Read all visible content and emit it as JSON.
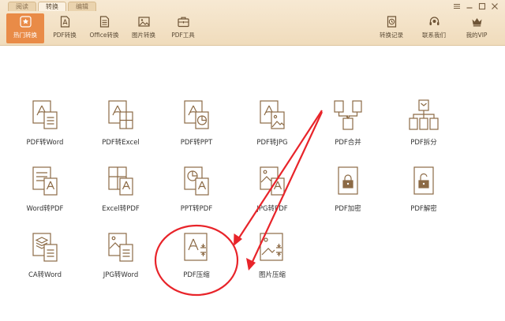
{
  "mode_tabs": [
    {
      "label": "阅读",
      "active": false
    },
    {
      "label": "转换",
      "active": true
    },
    {
      "label": "编辑",
      "active": false
    }
  ],
  "toolbar": [
    {
      "label": "热门转换",
      "icon": "star-icon",
      "active": true
    },
    {
      "label": "PDF转换",
      "icon": "pdf-icon",
      "active": false
    },
    {
      "label": "Office转换",
      "icon": "office-doc-icon",
      "active": false
    },
    {
      "label": "图片转换",
      "icon": "image-icon",
      "active": false
    },
    {
      "label": "PDF工具",
      "icon": "toolbox-icon",
      "active": false
    }
  ],
  "toolbar_right": [
    {
      "label": "转换记录",
      "icon": "history-clock-icon"
    },
    {
      "label": "联系我们",
      "icon": "headset-icon"
    },
    {
      "label": "我的VIP",
      "icon": "crown-icon"
    }
  ],
  "features": [
    {
      "label": "PDF转Word",
      "icon": "pdf-to-word-icon"
    },
    {
      "label": "PDF转Excel",
      "icon": "pdf-to-excel-icon"
    },
    {
      "label": "PDF转PPT",
      "icon": "pdf-to-ppt-icon"
    },
    {
      "label": "PDF转JPG",
      "icon": "pdf-to-jpg-icon"
    },
    {
      "label": "PDF合并",
      "icon": "pdf-merge-icon"
    },
    {
      "label": "PDF拆分",
      "icon": "pdf-split-icon"
    },
    {
      "label": "Word转PDF",
      "icon": "word-to-pdf-icon"
    },
    {
      "label": "Excel转PDF",
      "icon": "excel-to-pdf-icon"
    },
    {
      "label": "PPT转PDF",
      "icon": "ppt-to-pdf-icon"
    },
    {
      "label": "JPG转PDF",
      "icon": "jpg-to-pdf-icon"
    },
    {
      "label": "PDF加密",
      "icon": "pdf-encrypt-icon"
    },
    {
      "label": "PDF解密",
      "icon": "pdf-decrypt-icon"
    },
    {
      "label": "CA转Word",
      "icon": "cad-to-word-icon"
    },
    {
      "label": "JPG转Word",
      "icon": "jpg-to-word-icon"
    },
    {
      "label": "PDF压缩",
      "icon": "pdf-compress-icon"
    },
    {
      "label": "图片压缩",
      "icon": "image-compress-icon"
    }
  ],
  "colors": {
    "accent": "#e98b47",
    "toolbar_bg": "#f2e0c4",
    "icon_stroke": "#8c6a45",
    "annotation_red": "#e8242a"
  }
}
